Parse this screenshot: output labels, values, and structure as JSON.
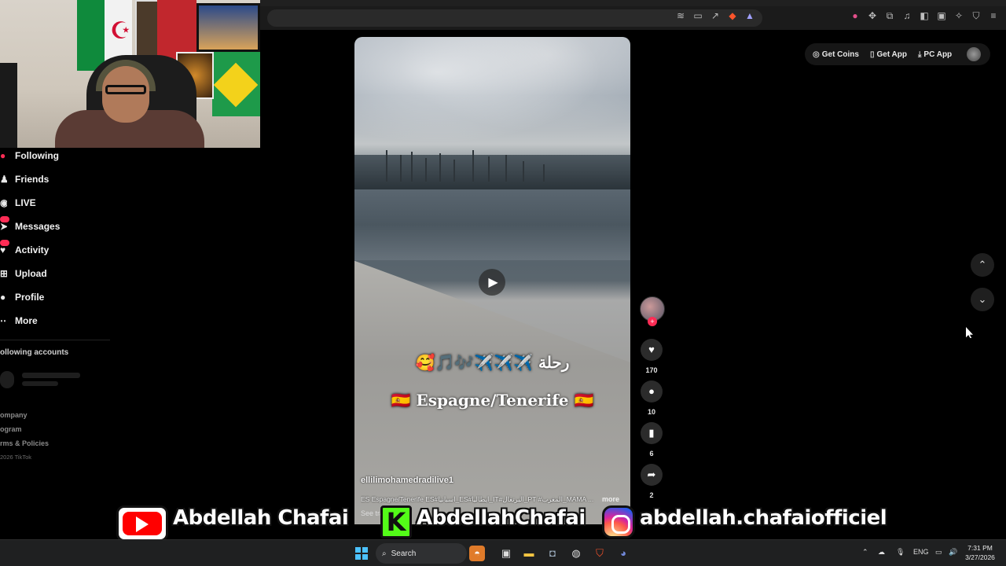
{
  "sidebar": {
    "items": [
      {
        "label": "Following",
        "icon": "following-icon"
      },
      {
        "label": "Friends",
        "icon": "friends-icon"
      },
      {
        "label": "LIVE",
        "icon": "live-icon"
      },
      {
        "label": "Messages",
        "icon": "messages-icon"
      },
      {
        "label": "Activity",
        "icon": "activity-icon"
      },
      {
        "label": "Upload",
        "icon": "upload-icon"
      },
      {
        "label": "Profile",
        "icon": "profile-icon"
      },
      {
        "label": "More",
        "icon": "more-icon"
      }
    ],
    "following_accounts_title": "ollowing accounts",
    "footer": [
      "ompany",
      "ogram",
      "rms & Policies"
    ],
    "copyright": "2026 TikTok"
  },
  "top_actions": {
    "get_coins": "Get Coins",
    "get_app": "Get App",
    "pc_app": "PC App"
  },
  "video": {
    "caption_arabic": "🥰🎵🎶✈️✈️✈️ رحلة",
    "caption_main": "🇪🇸 Espagne/Tenerife 🇪🇸",
    "username": "ellilimohamedradilive1",
    "description": "ES Espagne/Tenerife ES#اسبانيا_ES#ايطاليا_IT#البرتغال_PT #المغرب_MAMA ...",
    "more_label": "more",
    "see_translation": "See translation"
  },
  "actions": {
    "likes": "170",
    "comments": "10",
    "saves": "6",
    "shares": "2"
  },
  "social": {
    "youtube": "Abdellah Chafai",
    "kick": "AbdellahChafai",
    "instagram": "abdellah.chafaiofficiel",
    "accent_youtube": "#ff0000",
    "accent_kick": "#53fc18"
  },
  "taskbar": {
    "search_label": "Search",
    "language": "ENG",
    "time": "7:31 PM",
    "date": "3/27/2026"
  },
  "colors": {
    "background": "#000000",
    "tiktok_red": "#fe2c55"
  }
}
